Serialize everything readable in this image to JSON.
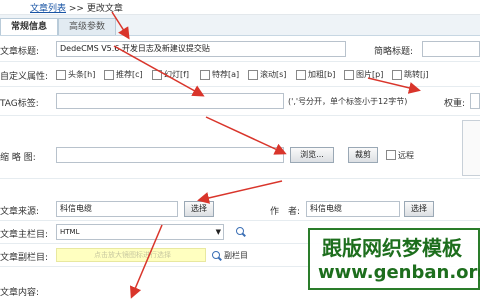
{
  "breadcrumb": {
    "link": "文章列表",
    "sep": ">>",
    "current": "更改文章"
  },
  "tabs": [
    {
      "label": "常规信息",
      "active": true
    },
    {
      "label": "高级参数",
      "active": false
    }
  ],
  "form": {
    "title_label": "文章标题:",
    "title_value": "DedeCMS V5.6 开发日志及新建议提交贴",
    "short_title_label": "简略标题:",
    "custom_attr_label": "自定义属性:",
    "attrs": [
      "头条[h]",
      "推荐[c]",
      "幻灯[f]",
      "特荐[a]",
      "滚动[s]",
      "加粗[b]",
      "图片[p]",
      "跳转[j]"
    ],
    "tag_label": "TAG标签:",
    "tag_hint": "(','号分开，单个标签小于12字节)",
    "weight_label": "权重:",
    "thumb_label": "缩 略 图:",
    "browse_button": "浏览...",
    "crop_button": "裁剪",
    "remote_label": "远程",
    "source_label": "文章来源:",
    "source_value": "科信电缆",
    "source_select": "选择",
    "author_label": "作　者:",
    "author_value": "科信电缆",
    "author_select": "选择",
    "main_column_label": "文章主栏目:",
    "main_column_value": "HTML",
    "sub_column_label": "文章副栏目:",
    "sub_column_hint": "点击放大镜图标进行选择",
    "sub_column_link": "副栏目",
    "content_label": "文章内容:"
  },
  "watermark": {
    "cn": "跟版网织梦模板",
    "en": "www.genban.org"
  },
  "colors": {
    "arrow": "#d9352b",
    "watermark": "#1d6e1d",
    "highlight": "#ffffc0"
  }
}
